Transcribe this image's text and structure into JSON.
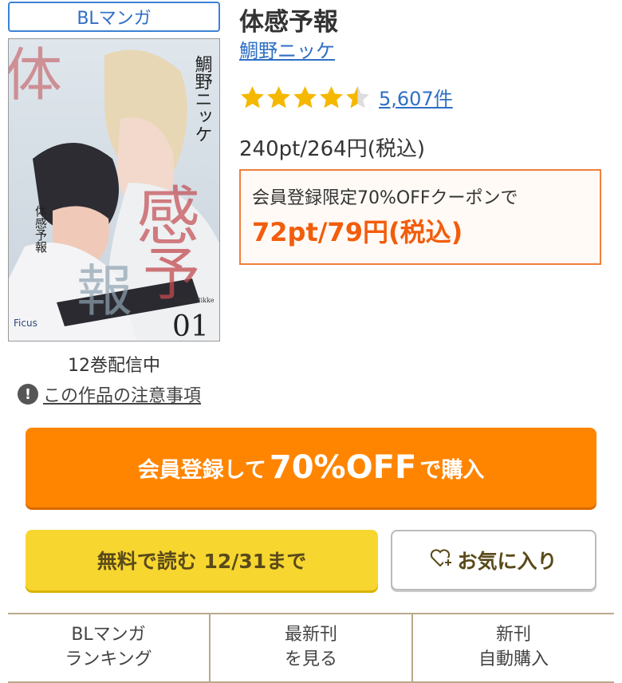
{
  "genre_badge": "BLマンガ",
  "book": {
    "title": "体感予報",
    "author": "鯛野ニッケ",
    "rating": 4.5,
    "review_count": "5,607件",
    "price": "240pt/264円(税込)",
    "volumes_text": "12巻配信中",
    "caution_link": "この作品の注意事項"
  },
  "cover": {
    "title_vertical": "体感予報",
    "author_vertical": "鯛野ニッケ",
    "big_chars": [
      "体",
      "感",
      "予",
      "報"
    ],
    "volume": "01",
    "publisher": "Ficus",
    "author_roman": "Eulee Nikke"
  },
  "coupon": {
    "label": "会員登録限定70%OFFクーポンで",
    "price": "72pt/79円(税込)"
  },
  "buttons": {
    "buy_pre": "会員登録して",
    "buy_emph": "70%OFF",
    "buy_post": "で購入",
    "free_read": "無料で読む 12/31まで",
    "favorite": "お気に入り"
  },
  "bottom_nav": [
    {
      "label": "BLマンガ\nランキング"
    },
    {
      "label": "最新刊\nを見る"
    },
    {
      "label": "新刊\n自動購入"
    }
  ],
  "colors": {
    "link": "#2f6fc4",
    "star": "#f5b800",
    "buy": "#ff8500",
    "free": "#f7d630",
    "coupon_price": "#f25d0c"
  }
}
